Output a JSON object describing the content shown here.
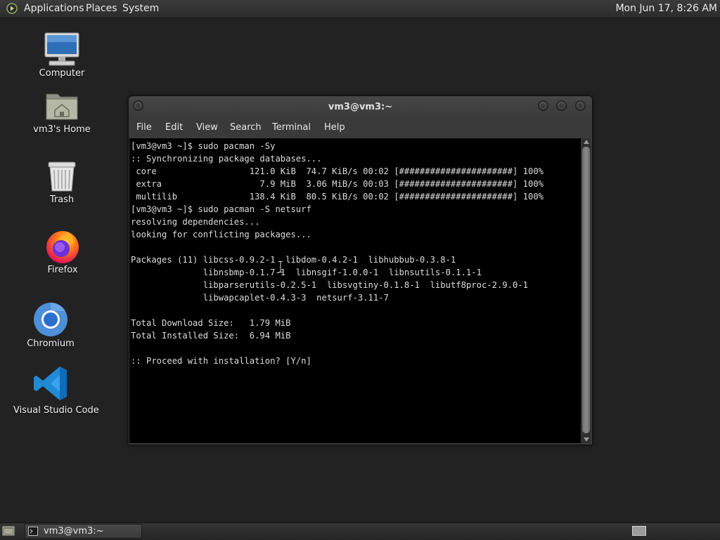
{
  "top_panel": {
    "menus": [
      "Applications",
      "Places",
      "System"
    ],
    "clock": "Mon Jun 17,  8:26 AM"
  },
  "desktop_icons": [
    {
      "label": "Computer",
      "icon": "computer-icon"
    },
    {
      "label": "vm3's Home",
      "icon": "home-folder-icon"
    },
    {
      "label": "Trash",
      "icon": "trash-icon"
    },
    {
      "label": "Firefox",
      "icon": "firefox-icon"
    },
    {
      "label": "Chromium",
      "icon": "chromium-icon"
    },
    {
      "label": "Visual Studio Code",
      "icon": "vscode-icon"
    }
  ],
  "terminal": {
    "title": "vm3@vm3:~",
    "menus": [
      "File",
      "Edit",
      "View",
      "Search",
      "Terminal",
      "Help"
    ],
    "lines": [
      "[vm3@vm3 ~]$ sudo pacman -Sy",
      ":: Synchronizing package databases...",
      " core                  121.0 KiB  74.7 KiB/s 00:02 [######################] 100%",
      " extra                   7.9 MiB  3.06 MiB/s 00:03 [######################] 100%",
      " multilib              138.4 KiB  80.5 KiB/s 00:02 [######################] 100%",
      "[vm3@vm3 ~]$ sudo pacman -S netsurf",
      "resolving dependencies...",
      "looking for conflicting packages...",
      "",
      "Packages (11) libcss-0.9.2-1  libdom-0.4.2-1  libhubbub-0.3.8-1",
      "              libnsbmp-0.1.7-1  libnsgif-1.0.0-1  libnsutils-0.1.1-1",
      "              libparserutils-0.2.5-1  libsvgtiny-0.1.8-1  libutf8proc-2.9.0-1",
      "              libwapcaplet-0.4.3-3  netsurf-3.11-7",
      "",
      "Total Download Size:   1.79 MiB",
      "Total Installed Size:  6.94 MiB",
      "",
      ":: Proceed with installation? [Y/n]"
    ]
  },
  "taskbar": {
    "window_label": "vm3@vm3:~"
  },
  "colors": {
    "desktop_bg": "#222222",
    "panel_bg": "#2f2f2f",
    "terminal_bg": "#000000",
    "terminal_fg": "#dcdcdc"
  }
}
